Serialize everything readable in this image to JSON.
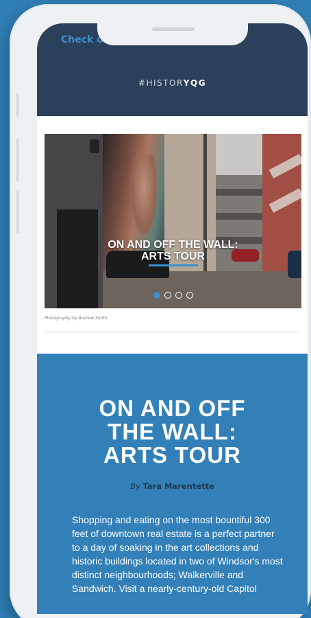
{
  "header": {
    "partial_link": "Check ou",
    "hashtag_prefix": "#HISTOR",
    "hashtag_bold": "YQG"
  },
  "hero": {
    "caption_line1": "ON AND OFF THE WALL:",
    "caption_line2": "ARTS TOUR",
    "slides_total": 4,
    "slide_active": 1
  },
  "photo_credit": "Photography by Andrew Smith",
  "article": {
    "title_line1": "ON AND OFF",
    "title_line2": "THE WALL:",
    "title_line3": "ARTS TOUR",
    "by_prefix": "By",
    "author": "Tara Marentette",
    "body": "Shopping and eating on the most bountiful 300 feet of downtown real estate is a perfect partner to a day of soaking in the art collections and historic buildings located in two of Windsor's most distinct neighbourhoods; Walkerville and Sandwich. Visit a nearly-century-old Capitol"
  },
  "colors": {
    "header_bg": "#2b405a",
    "accent": "#3a8fcf",
    "article_bg": "#3380b9",
    "page_bg": "#2f7fb6"
  }
}
